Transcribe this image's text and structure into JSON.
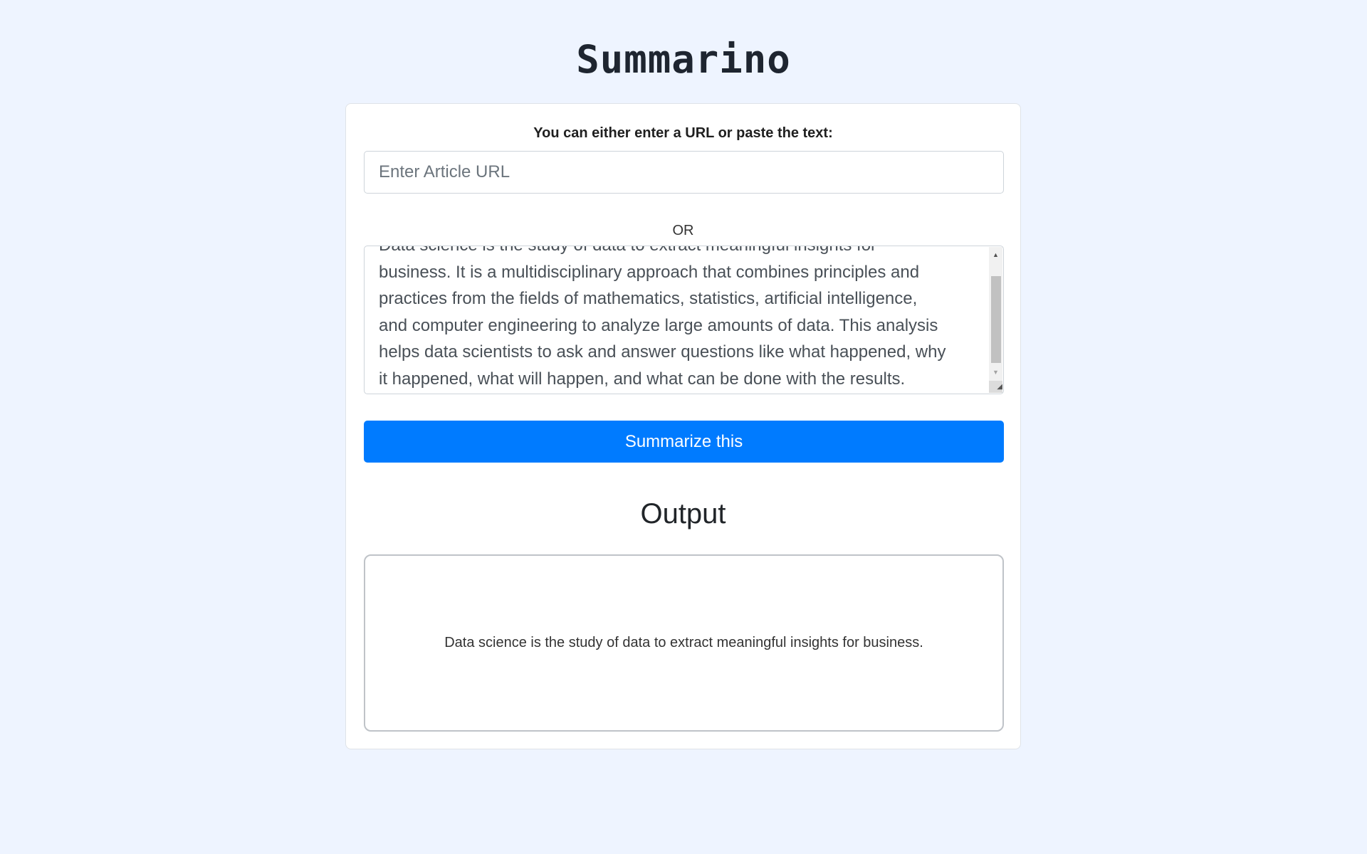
{
  "app": {
    "title": "Summarino"
  },
  "form": {
    "prompt_label": "You can either enter a URL or paste the text:",
    "url_placeholder": "Enter Article URL",
    "url_value": "",
    "or_label": "OR",
    "text_lines": [
      "Data science is the study of data to extract meaningful insights for",
      "business. It is a multidisciplinary approach that combines principles and",
      "practices from the fields of mathematics, statistics, artificial intelligence,",
      "and computer engineering to analyze large amounts of data. This analysis",
      "helps data scientists to ask and answer questions like what happened, why",
      "it happened, what will happen, and what can be done with the results."
    ],
    "submit_label": "Summarize this"
  },
  "output": {
    "heading": "Output",
    "summary": "Data science is the study of data to extract meaningful insights for business."
  },
  "colors": {
    "page_background": "#eef4ff",
    "accent": "#007bff"
  },
  "icons": {
    "scroll_up": "triangle-up-icon",
    "scroll_down": "triangle-down-icon",
    "resize": "resize-grip-icon"
  }
}
